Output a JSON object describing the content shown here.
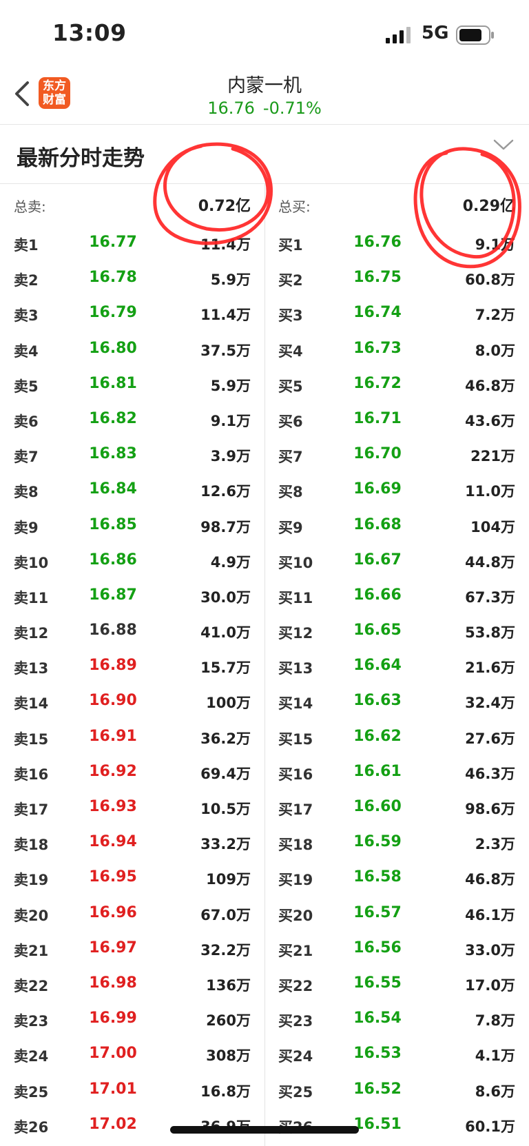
{
  "status_bar": {
    "time": "13:09",
    "network": "5G"
  },
  "header": {
    "title": "内蒙一机",
    "price": "16.76",
    "change_percent": "-0.71%",
    "logo_text": [
      "东方",
      "财富"
    ]
  },
  "section": {
    "title": "最新分时走势"
  },
  "colors": {
    "up": "#e02020",
    "down": "#14a014",
    "neutral": "#333333",
    "annotation": "#ff2020",
    "brand": "#f15a22"
  },
  "order_book": {
    "sell": {
      "total_label": "总卖:",
      "total_value": "0.72亿",
      "levels": [
        {
          "label": "卖1",
          "price": "16.77",
          "volume": "11.4万",
          "color": "green"
        },
        {
          "label": "卖2",
          "price": "16.78",
          "volume": "5.9万",
          "color": "green"
        },
        {
          "label": "卖3",
          "price": "16.79",
          "volume": "11.4万",
          "color": "green"
        },
        {
          "label": "卖4",
          "price": "16.80",
          "volume": "37.5万",
          "color": "green"
        },
        {
          "label": "卖5",
          "price": "16.81",
          "volume": "5.9万",
          "color": "green"
        },
        {
          "label": "卖6",
          "price": "16.82",
          "volume": "9.1万",
          "color": "green"
        },
        {
          "label": "卖7",
          "price": "16.83",
          "volume": "3.9万",
          "color": "green"
        },
        {
          "label": "卖8",
          "price": "16.84",
          "volume": "12.6万",
          "color": "green"
        },
        {
          "label": "卖9",
          "price": "16.85",
          "volume": "98.7万",
          "color": "green"
        },
        {
          "label": "卖10",
          "price": "16.86",
          "volume": "4.9万",
          "color": "green"
        },
        {
          "label": "卖11",
          "price": "16.87",
          "volume": "30.0万",
          "color": "green"
        },
        {
          "label": "卖12",
          "price": "16.88",
          "volume": "41.0万",
          "color": "neutral"
        },
        {
          "label": "卖13",
          "price": "16.89",
          "volume": "15.7万",
          "color": "red"
        },
        {
          "label": "卖14",
          "price": "16.90",
          "volume": "100万",
          "color": "red"
        },
        {
          "label": "卖15",
          "price": "16.91",
          "volume": "36.2万",
          "color": "red"
        },
        {
          "label": "卖16",
          "price": "16.92",
          "volume": "69.4万",
          "color": "red"
        },
        {
          "label": "卖17",
          "price": "16.93",
          "volume": "10.5万",
          "color": "red"
        },
        {
          "label": "卖18",
          "price": "16.94",
          "volume": "33.2万",
          "color": "red"
        },
        {
          "label": "卖19",
          "price": "16.95",
          "volume": "109万",
          "color": "red"
        },
        {
          "label": "卖20",
          "price": "16.96",
          "volume": "67.0万",
          "color": "red"
        },
        {
          "label": "卖21",
          "price": "16.97",
          "volume": "32.2万",
          "color": "red"
        },
        {
          "label": "卖22",
          "price": "16.98",
          "volume": "136万",
          "color": "red"
        },
        {
          "label": "卖23",
          "price": "16.99",
          "volume": "260万",
          "color": "red"
        },
        {
          "label": "卖24",
          "price": "17.00",
          "volume": "308万",
          "color": "red"
        },
        {
          "label": "卖25",
          "price": "17.01",
          "volume": "16.8万",
          "color": "red"
        },
        {
          "label": "卖26",
          "price": "17.02",
          "volume": "36.9万",
          "color": "red"
        }
      ]
    },
    "buy": {
      "total_label": "总买:",
      "total_value": "0.29亿",
      "levels": [
        {
          "label": "买1",
          "price": "16.76",
          "volume": "9.1万",
          "color": "green"
        },
        {
          "label": "买2",
          "price": "16.75",
          "volume": "60.8万",
          "color": "green"
        },
        {
          "label": "买3",
          "price": "16.74",
          "volume": "7.2万",
          "color": "green"
        },
        {
          "label": "买4",
          "price": "16.73",
          "volume": "8.0万",
          "color": "green"
        },
        {
          "label": "买5",
          "price": "16.72",
          "volume": "46.8万",
          "color": "green"
        },
        {
          "label": "买6",
          "price": "16.71",
          "volume": "43.6万",
          "color": "green"
        },
        {
          "label": "买7",
          "price": "16.70",
          "volume": "221万",
          "color": "green"
        },
        {
          "label": "买8",
          "price": "16.69",
          "volume": "11.0万",
          "color": "green"
        },
        {
          "label": "买9",
          "price": "16.68",
          "volume": "104万",
          "color": "green"
        },
        {
          "label": "买10",
          "price": "16.67",
          "volume": "44.8万",
          "color": "green"
        },
        {
          "label": "买11",
          "price": "16.66",
          "volume": "67.3万",
          "color": "green"
        },
        {
          "label": "买12",
          "price": "16.65",
          "volume": "53.8万",
          "color": "green"
        },
        {
          "label": "买13",
          "price": "16.64",
          "volume": "21.6万",
          "color": "green"
        },
        {
          "label": "买14",
          "price": "16.63",
          "volume": "32.4万",
          "color": "green"
        },
        {
          "label": "买15",
          "price": "16.62",
          "volume": "27.6万",
          "color": "green"
        },
        {
          "label": "买16",
          "price": "16.61",
          "volume": "46.3万",
          "color": "green"
        },
        {
          "label": "买17",
          "price": "16.60",
          "volume": "98.6万",
          "color": "green"
        },
        {
          "label": "买18",
          "price": "16.59",
          "volume": "2.3万",
          "color": "green"
        },
        {
          "label": "买19",
          "price": "16.58",
          "volume": "46.8万",
          "color": "green"
        },
        {
          "label": "买20",
          "price": "16.57",
          "volume": "46.1万",
          "color": "green"
        },
        {
          "label": "买21",
          "price": "16.56",
          "volume": "33.0万",
          "color": "green"
        },
        {
          "label": "买22",
          "price": "16.55",
          "volume": "17.0万",
          "color": "green"
        },
        {
          "label": "买23",
          "price": "16.54",
          "volume": "7.8万",
          "color": "green"
        },
        {
          "label": "买24",
          "price": "16.53",
          "volume": "4.1万",
          "color": "green"
        },
        {
          "label": "买25",
          "price": "16.52",
          "volume": "8.6万",
          "color": "green"
        },
        {
          "label": "买26",
          "price": "16.51",
          "volume": "60.1万",
          "color": "green"
        }
      ]
    }
  }
}
